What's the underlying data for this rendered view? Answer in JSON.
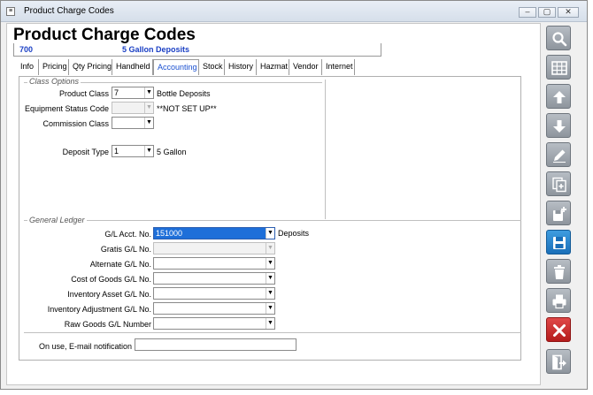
{
  "window": {
    "title": "Product Charge Codes",
    "icon_glyph": "≡",
    "controls": {
      "minimize": "–",
      "maximize": "▢",
      "close": "✕"
    }
  },
  "page_title": "Product Charge Codes",
  "record": {
    "code": "700",
    "description": "5 Gallon Deposits"
  },
  "tabs": [
    {
      "label": "Info"
    },
    {
      "label": "Pricing"
    },
    {
      "label": "Qty Pricing"
    },
    {
      "label": "Handheld"
    },
    {
      "label": "Accounting",
      "active": true
    },
    {
      "label": "Stock"
    },
    {
      "label": "History"
    },
    {
      "label": "Hazmat"
    },
    {
      "label": "Vendor"
    },
    {
      "label": "Internet"
    }
  ],
  "class_options": {
    "title": "Class Options",
    "product_class": {
      "label": "Product Class",
      "value": "7",
      "description": "Bottle Deposits"
    },
    "equipment_status_code": {
      "label": "Equipment Status Code",
      "value": "",
      "description": "**NOT SET UP**"
    },
    "commission_class": {
      "label": "Commission Class",
      "value": ""
    },
    "deposit_type": {
      "label": "Deposit Type",
      "value": "1",
      "description": "5 Gallon"
    }
  },
  "general_ledger": {
    "title": "General Ledger",
    "gl_acct_no": {
      "label": "G/L Acct. No.",
      "value": "151000",
      "description": "Deposits"
    },
    "gratis_gl_no": {
      "label": "Gratis G/L No.",
      "value": ""
    },
    "alternate_gl_no": {
      "label": "Alternate G/L No.",
      "value": ""
    },
    "cost_of_goods_gl_no": {
      "label": "Cost of Goods G/L No.",
      "value": ""
    },
    "inventory_asset_gl_no": {
      "label": "Inventory Asset G/L No.",
      "value": ""
    },
    "inventory_adjustment_gl_no": {
      "label": "Inventory Adjustment G/L No.",
      "value": ""
    },
    "raw_goods_gl_number": {
      "label": "Raw Goods G/L Number",
      "value": ""
    }
  },
  "email_notification": {
    "label": "On use, E-mail notification",
    "value": ""
  },
  "dropdown_arrow": "▼",
  "toolbar": [
    {
      "name": "search-button",
      "icon": "magnifier-icon"
    },
    {
      "name": "grid-view-button",
      "icon": "grid-icon"
    },
    {
      "name": "previous-record-button",
      "icon": "arrow-up-icon"
    },
    {
      "name": "next-record-button",
      "icon": "arrow-down-icon"
    },
    {
      "name": "edit-button",
      "icon": "pencil-icon"
    },
    {
      "name": "copy-button",
      "icon": "copy-pages-icon"
    },
    {
      "name": "new-record-button",
      "icon": "add-document-icon"
    },
    {
      "name": "save-button",
      "icon": "floppy-disk-icon"
    },
    {
      "name": "delete-button",
      "icon": "trash-icon"
    },
    {
      "name": "print-button",
      "icon": "printer-icon"
    },
    {
      "name": "cancel-button",
      "icon": "x-icon"
    },
    {
      "name": "exit-button",
      "icon": "exit-door-icon"
    }
  ],
  "colors": {
    "accent": "#1a50d0",
    "record_text": "#1a3fc4",
    "selection": "#1e6fd9",
    "save_blue": "#1a6fb9",
    "cancel_red": "#b51c1c"
  }
}
